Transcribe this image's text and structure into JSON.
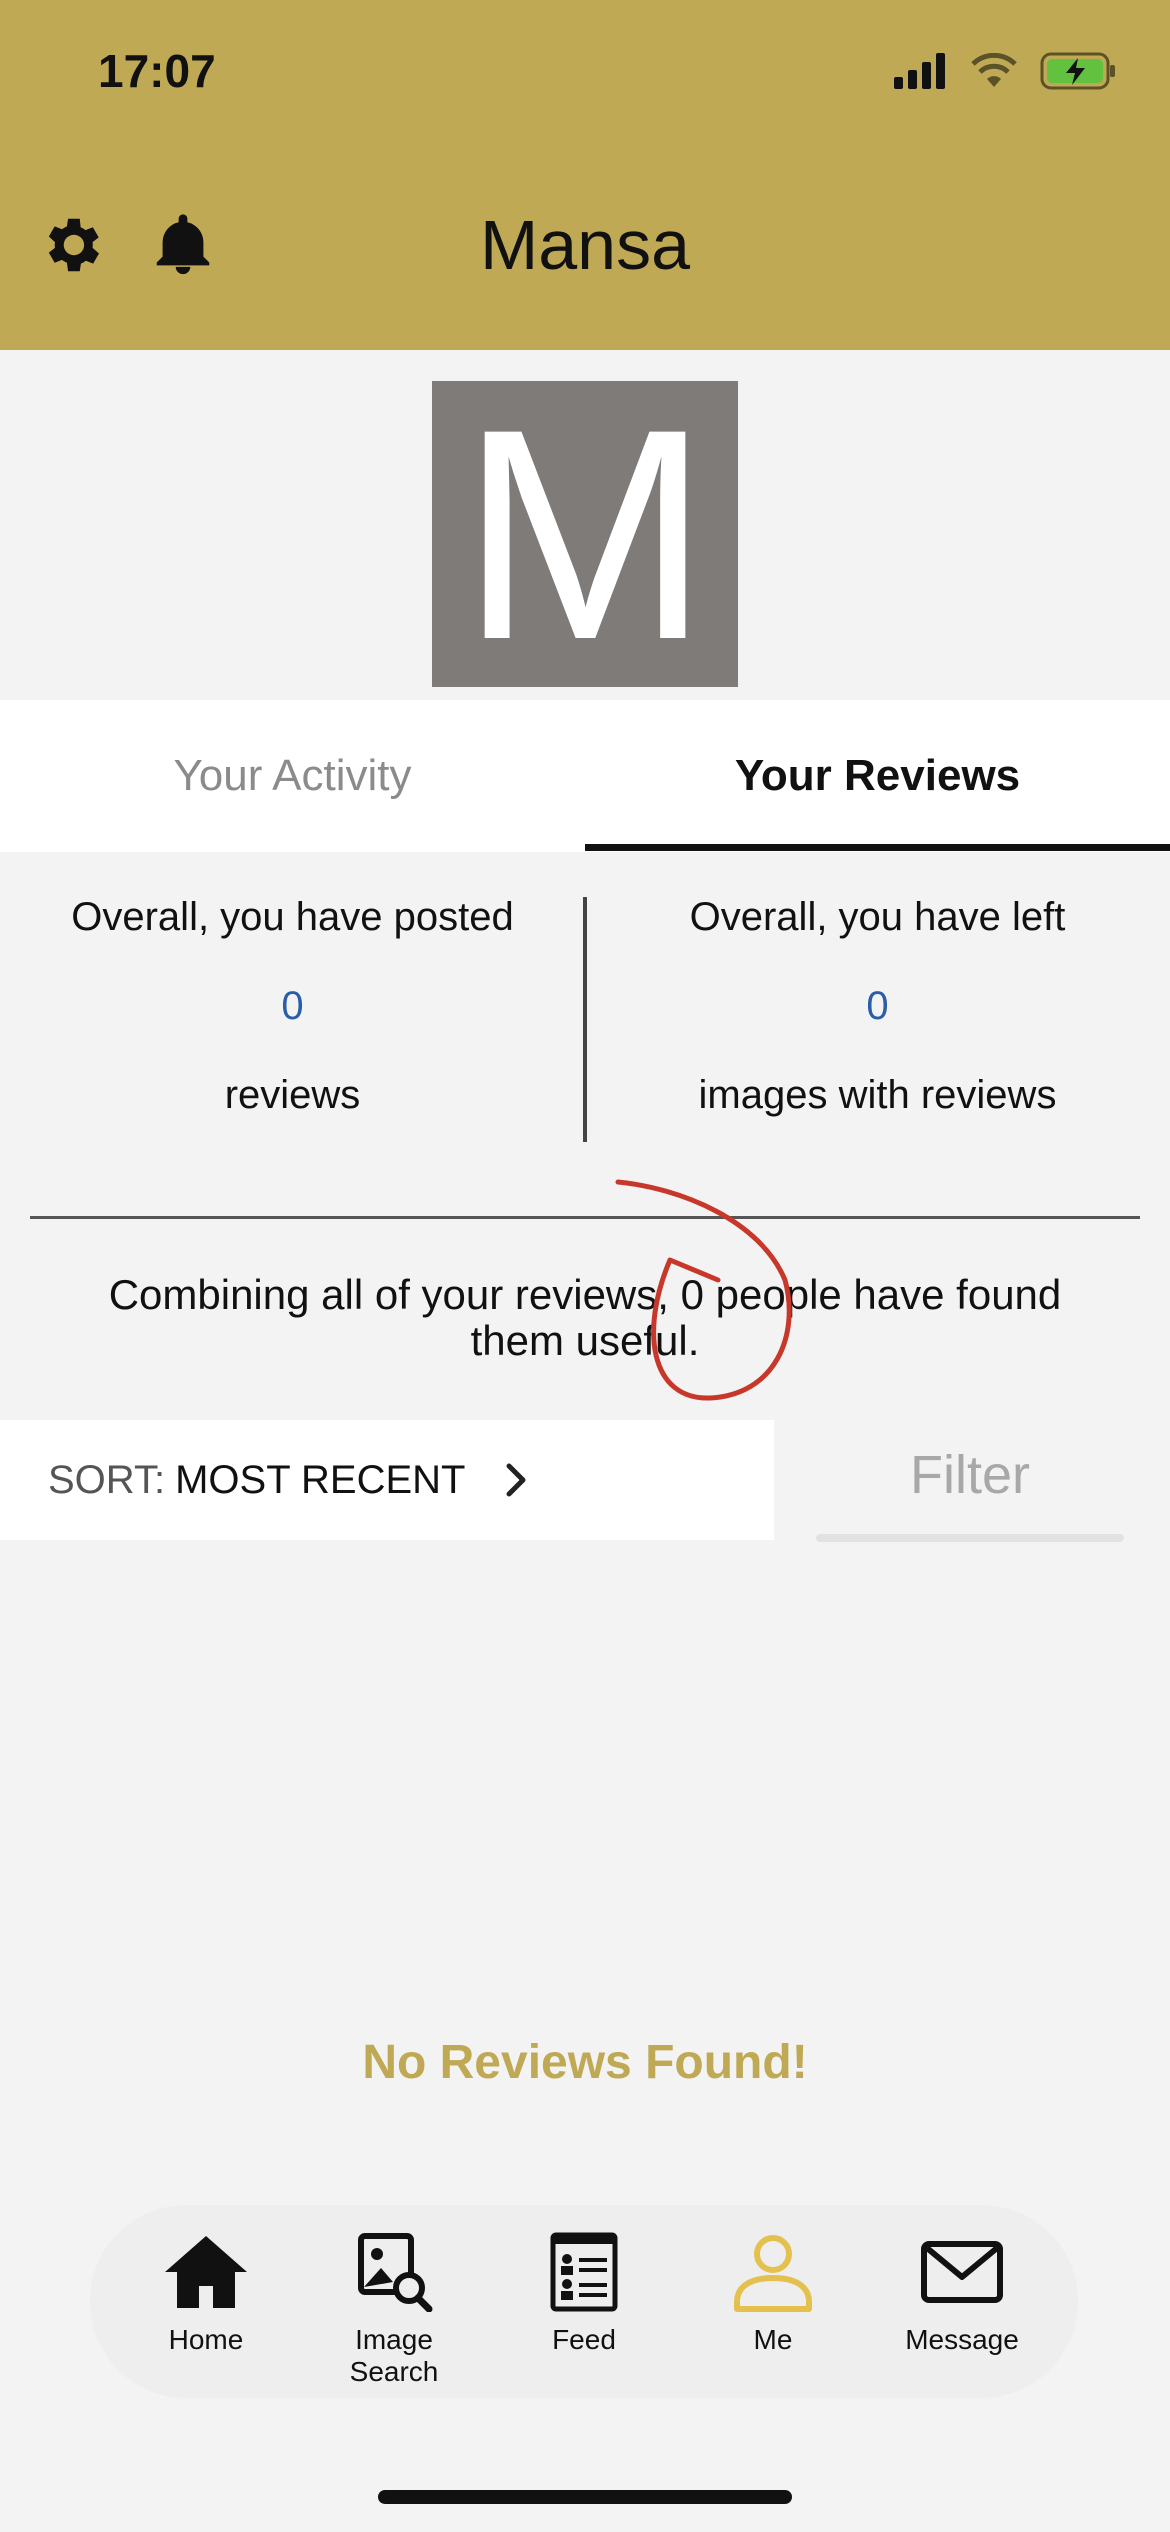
{
  "status_bar": {
    "time": "17:07"
  },
  "header": {
    "title": "Mansa",
    "settings_icon": "gear-icon",
    "notifications_icon": "bell-icon"
  },
  "avatar": {
    "initial": "M"
  },
  "tabs": [
    {
      "label": "Your Activity",
      "active": false
    },
    {
      "label": "Your Reviews",
      "active": true
    }
  ],
  "stats": {
    "left": {
      "line1": "Overall, you have posted",
      "value": "0",
      "line3": "reviews"
    },
    "right": {
      "line1": "Overall, you have left",
      "value": "0",
      "line3": "images with reviews"
    }
  },
  "combined_text": "Combining all of your reviews, 0 people have found them useful.",
  "sort": {
    "label": "SORT:",
    "value": "MOST RECENT"
  },
  "filter": {
    "label": "Filter"
  },
  "empty_state": "No Reviews Found!",
  "bottom_nav": [
    {
      "label": "Home",
      "icon": "home-icon",
      "active": false
    },
    {
      "label": "Image Search",
      "icon": "image-search-icon",
      "active": false
    },
    {
      "label": "Feed",
      "icon": "feed-icon",
      "active": false
    },
    {
      "label": "Me",
      "icon": "person-icon",
      "active": true
    },
    {
      "label": "Message",
      "icon": "envelope-icon",
      "active": false
    }
  ],
  "colors": {
    "brand": "#bfa954",
    "link": "#2a5ea8",
    "annotation": "#c8382a"
  }
}
